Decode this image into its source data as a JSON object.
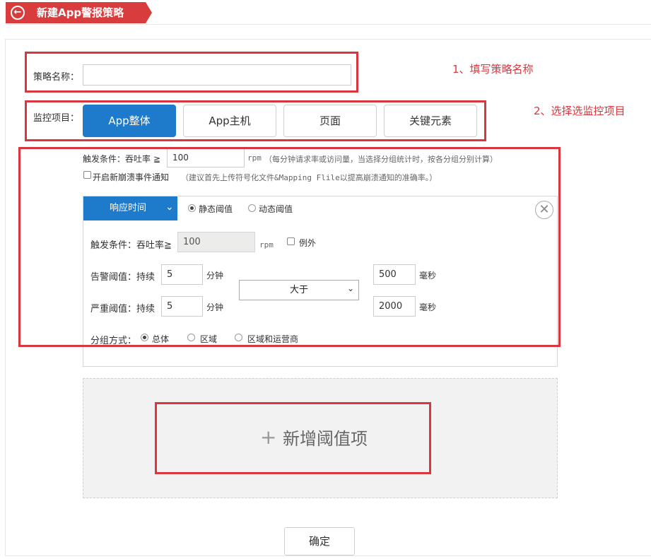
{
  "header": {
    "back_icon": "circle-arrow-left-icon",
    "title": "新建App警报策略"
  },
  "annotations": {
    "step1": "1、填写策略名称",
    "step2": "2、选择选监控项目"
  },
  "form": {
    "name_label": "策略名称：",
    "name_value": "",
    "monitor_label": "监控项目：",
    "tabs": [
      {
        "label": "App整体",
        "active": true
      },
      {
        "label": "App主机",
        "active": false
      },
      {
        "label": "页面",
        "active": false
      },
      {
        "label": "关键元素",
        "active": false
      }
    ],
    "trigger_label": "触发条件：吞吐率 ≧",
    "trigger_value": "100",
    "trigger_unit": "rpm",
    "trigger_note": "（每分钟请求率或访问量，当选择分组统计时，按各分组分别计算）",
    "crash_checkbox_label": "开启新崩溃事件通知",
    "crash_note": "（建议首先上传符号化文件&Mapping Flile以提高崩溃通知的准确率。）"
  },
  "threshold": {
    "metric": "响应时间",
    "mode_static": "静态阈值",
    "mode_dynamic": "动态阈值",
    "trigger_label": "触发条件：吞吐率≧",
    "trigger_value": "100",
    "trigger_unit": "rpm",
    "exception_label": "例外",
    "warn_label": "告警阈值：持续",
    "warn_minutes": "5",
    "minutes_unit": "分钟",
    "severe_label": "严重阈值：持续",
    "severe_minutes": "5",
    "compare_op": "大于",
    "warn_ms": "500",
    "severe_ms": "2000",
    "ms_unit": "毫秒",
    "group_label": "分组方式：",
    "group_options": [
      "总体",
      "区域",
      "区域和运营商"
    ]
  },
  "add_item": {
    "plus": "+",
    "label": "新增阈值项"
  },
  "confirm_label": "确定",
  "colors": {
    "header_red": "#d93c3c",
    "annotation_red": "#d9363e",
    "primary_blue": "#1e7bcb"
  }
}
